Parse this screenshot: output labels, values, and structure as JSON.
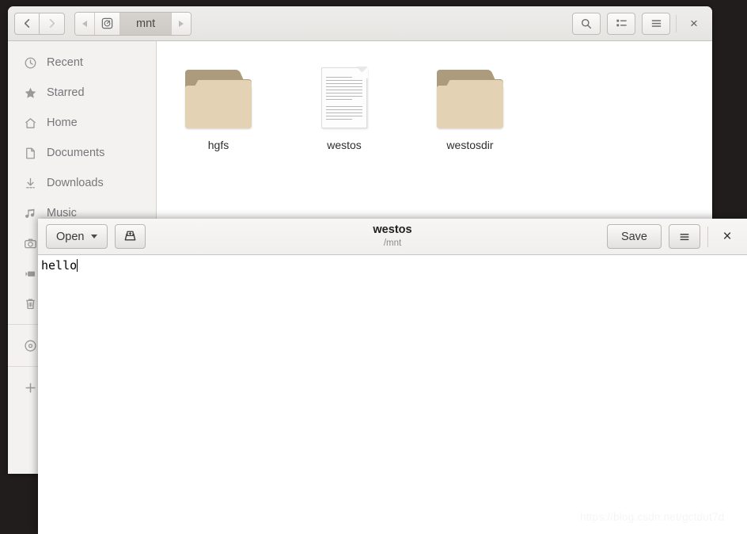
{
  "desktop": {
    "background_color": "#211d1d",
    "watermark": "https://blog.csdn.net/gctdut7d"
  },
  "file_manager": {
    "nav": {
      "back_label": "Back",
      "forward_label": "Forward"
    },
    "breadcrumb": {
      "prev_label": "",
      "device_label": "",
      "items": [
        {
          "label": "mnt",
          "active": true
        }
      ],
      "next_label": ""
    },
    "header_buttons": {
      "search_label": "Search",
      "view_label": "View options",
      "menu_label": "Menu",
      "close_label": "×"
    },
    "sidebar": {
      "items": [
        {
          "label": "Recent",
          "icon": "clock-icon"
        },
        {
          "label": "Starred",
          "icon": "star-icon"
        },
        {
          "label": "Home",
          "icon": "home-icon"
        },
        {
          "label": "Documents",
          "icon": "document-icon"
        },
        {
          "label": "Downloads",
          "icon": "download-icon"
        },
        {
          "label": "Music",
          "icon": "music-icon"
        },
        {
          "label": "Pictures",
          "icon": "camera-icon"
        },
        {
          "label": "Videos",
          "icon": "video-icon"
        },
        {
          "label": "Trash",
          "icon": "trash-icon"
        }
      ],
      "devices": [
        {
          "label": "Removable media",
          "icon": "disc-icon"
        }
      ],
      "other": [
        {
          "label": "Other Locations",
          "icon": "plus-icon"
        }
      ]
    },
    "files": [
      {
        "name": "hgfs",
        "type": "folder"
      },
      {
        "name": "westos",
        "type": "document"
      },
      {
        "name": "westosdir",
        "type": "folder"
      }
    ]
  },
  "editor": {
    "open_button": "Open",
    "new_document_label": "New document",
    "title": "westos",
    "subtitle": "/mnt",
    "save_button": "Save",
    "menu_label": "Menu",
    "close_label": "×",
    "content": "hello"
  }
}
